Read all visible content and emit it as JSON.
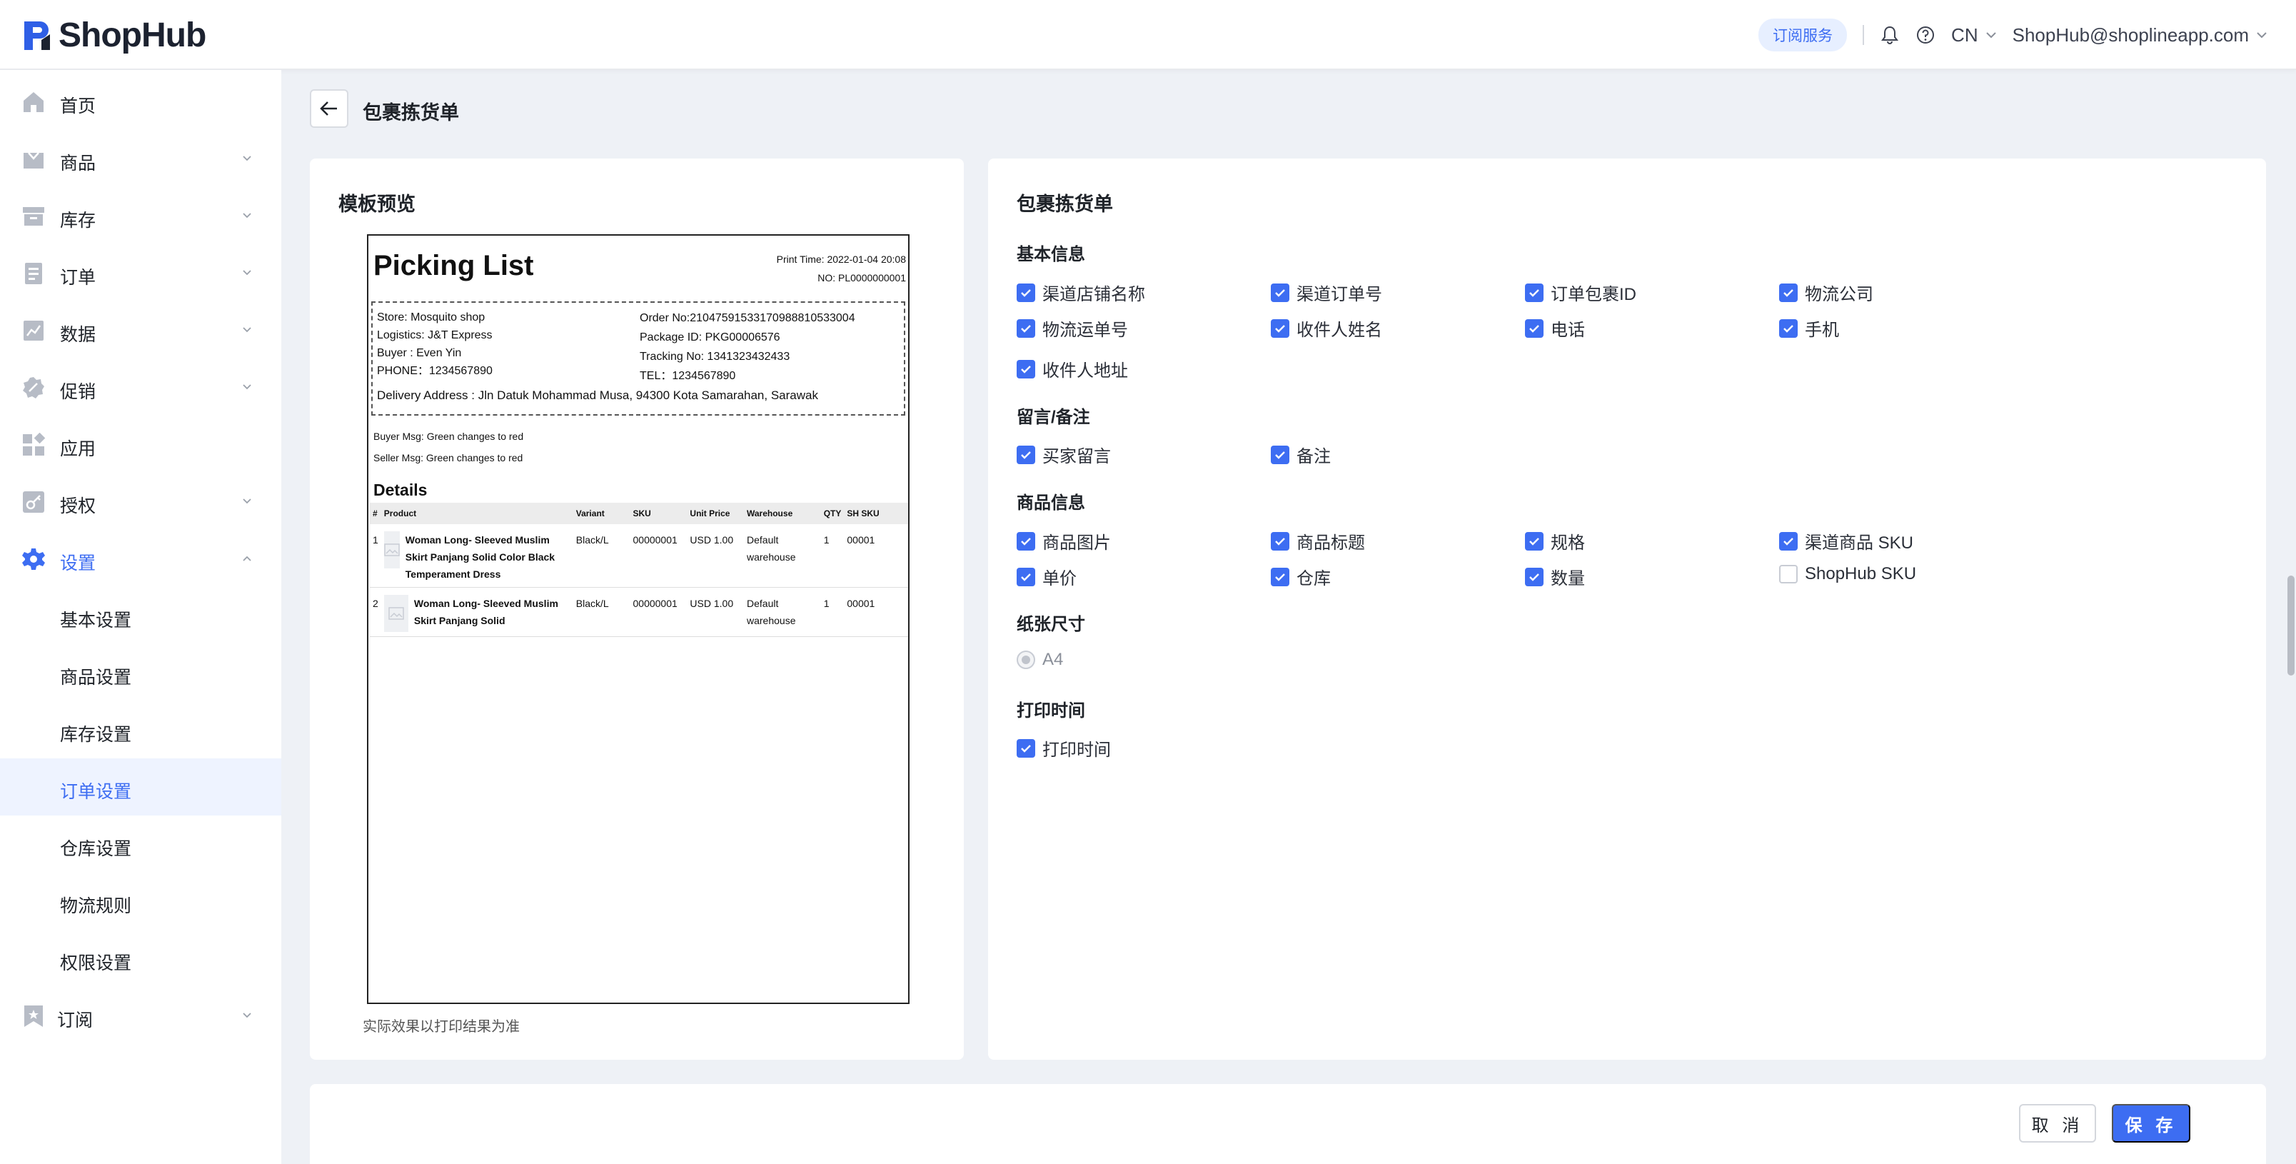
{
  "app": {
    "name": "ShopHub"
  },
  "header": {
    "subscription": "订阅服务",
    "language": "CN",
    "account": "ShopHub@shoplineapp.com"
  },
  "sidebar": {
    "items": [
      {
        "label": "首页",
        "icon": "home-icon"
      },
      {
        "label": "商品",
        "icon": "bag-icon"
      },
      {
        "label": "库存",
        "icon": "box-icon"
      },
      {
        "label": "订单",
        "icon": "document-icon"
      },
      {
        "label": "数据",
        "icon": "chart-icon"
      },
      {
        "label": "促销",
        "icon": "badge-icon"
      },
      {
        "label": "应用",
        "icon": "apps-icon"
      },
      {
        "label": "授权",
        "icon": "key-icon"
      },
      {
        "label": "设置",
        "icon": "gear-icon"
      }
    ],
    "settings_sub": [
      "基本设置",
      "商品设置",
      "库存设置",
      "订单设置",
      "仓库设置",
      "物流规则",
      "权限设置"
    ],
    "subscribe": "订阅"
  },
  "page": {
    "title": "包裹拣货单"
  },
  "preview": {
    "title": "模板预览",
    "note": "实际效果以打印结果为准",
    "doc": {
      "heading": "Picking List",
      "print_time": "Print Time: 2022-01-04 20:08",
      "no": "NO: PL0000000001",
      "store": "Store: Mosquito shop",
      "logistics": "Logistics: J&T Express",
      "buyer": "Buyer : Even Yin",
      "phone": "PHONE：1234567890",
      "order_no": "Order No:2104759153317098881053300​4",
      "package_id": "Package ID: PKG00006576",
      "tracking": "Tracking No: 1341323432433",
      "tel": "TEL：1234567890",
      "address": "Delivery Address : Jln Datuk Mohammad Musa, 94300 Kota Samarahan, Sarawak",
      "buyer_msg": "Buyer Msg:  Green changes to red",
      "seller_msg": "Seller Msg:  Green changes to red",
      "details": "Details",
      "columns": [
        "#",
        "Product",
        "Variant",
        "SKU",
        "Unit Price",
        "Warehouse",
        "QTY",
        "SH SKU"
      ],
      "rows": [
        {
          "no": "1",
          "product": "Woman Long- Sleeved Muslim Skirt Panjang Solid Color Black Temperament Dress",
          "variant": "Black/L",
          "sku": "00000001",
          "price": "USD 1.00",
          "warehouse": "Default warehouse",
          "qty": "1",
          "sh_sku": "00001"
        },
        {
          "no": "2",
          "product": "Woman Long- Sleeved Muslim Skirt Panjang Solid",
          "variant": "Black/L",
          "sku": "00000001",
          "price": "USD 1.00",
          "warehouse": "Default warehouse",
          "qty": "1",
          "sh_sku": "00001"
        }
      ]
    }
  },
  "settings": {
    "title": "包裹拣货单",
    "basic": {
      "title": "基本信息",
      "options": [
        {
          "label": "渠道店铺名称",
          "checked": true
        },
        {
          "label": "渠道订单号",
          "checked": true
        },
        {
          "label": "订单包裹ID",
          "checked": true
        },
        {
          "label": "物流公司",
          "checked": true
        },
        {
          "label": "物流运单号",
          "checked": true
        },
        {
          "label": "收件人姓名",
          "checked": true
        },
        {
          "label": "电话",
          "checked": true
        },
        {
          "label": "手机",
          "checked": true
        },
        {
          "label": "收件人地址",
          "checked": true
        }
      ]
    },
    "notes": {
      "title": "留言/备注",
      "options": [
        {
          "label": "买家留言",
          "checked": true
        },
        {
          "label": "备注",
          "checked": true
        }
      ]
    },
    "product": {
      "title": "商品信息",
      "options": [
        {
          "label": "商品图片",
          "checked": true
        },
        {
          "label": "商品标题",
          "checked": true
        },
        {
          "label": "规格",
          "checked": true
        },
        {
          "label": "渠道商品 SKU",
          "checked": true
        },
        {
          "label": "单价",
          "checked": true
        },
        {
          "label": "仓库",
          "checked": true
        },
        {
          "label": "数量",
          "checked": true
        },
        {
          "label": "ShopHub SKU",
          "checked": false
        }
      ]
    },
    "paper": {
      "title": "纸张尺寸",
      "option": "A4"
    },
    "print_time": {
      "title": "打印时间",
      "option": "打印时间",
      "checked": true
    }
  },
  "actions": {
    "cancel": "取 消",
    "save": "保 存"
  },
  "colors": {
    "accent": "#3d6df2",
    "background": "#eef1f6"
  }
}
